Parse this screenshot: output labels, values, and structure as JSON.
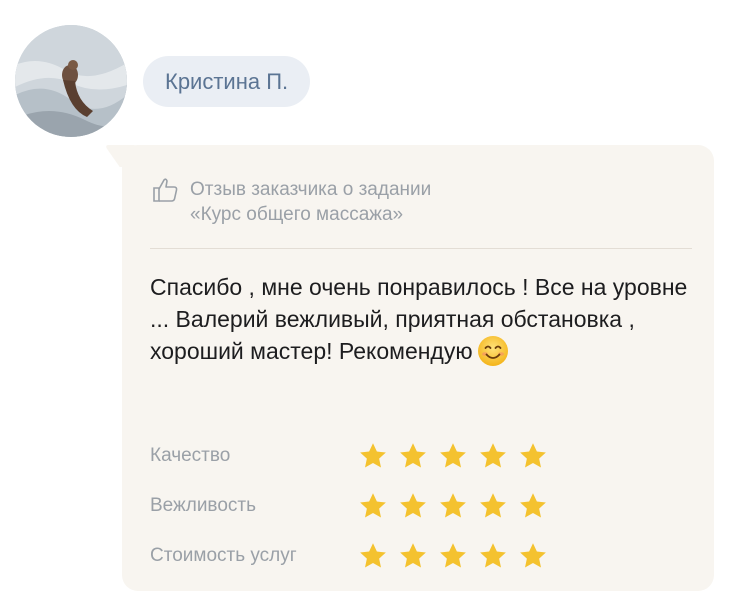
{
  "user": {
    "name": "Кристина П."
  },
  "review": {
    "header_line1": "Отзыв заказчика о задании",
    "header_line2": "«Курс общего массажа»",
    "text": "Спасибо , мне очень понравилось ! Все на уровне ... Валерий вежливый, приятная обстановка , хороший мастер! Рекомендую",
    "emoji_icon": "smiling-face-icon"
  },
  "ratings": [
    {
      "label": "Качество",
      "stars": 5,
      "max": 5
    },
    {
      "label": "Вежливость",
      "stars": 5,
      "max": 5
    },
    {
      "label": "Стоимость услуг",
      "stars": 5,
      "max": 5
    }
  ],
  "colors": {
    "star": "#f4c22f",
    "name_pill_bg": "#eaeef4",
    "name_text": "#5b7493",
    "card_bg": "#f8f5f0",
    "muted_text": "#9aa0a7"
  }
}
